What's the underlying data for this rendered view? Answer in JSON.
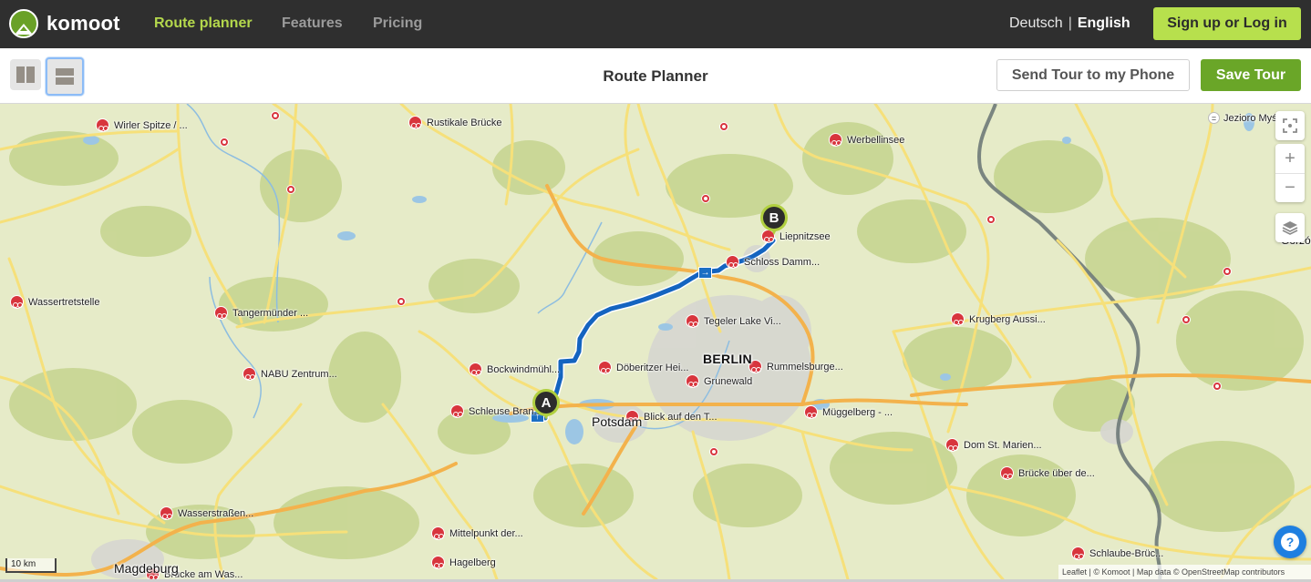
{
  "brand": {
    "name": "komoot",
    "accent": "#b4d84c",
    "primary_green": "#6aa628"
  },
  "topnav": {
    "links": [
      {
        "label": "Route planner",
        "active": true
      },
      {
        "label": "Features",
        "active": false
      },
      {
        "label": "Pricing",
        "active": false
      }
    ],
    "languages": {
      "other": "Deutsch",
      "separator": "|",
      "current": "English"
    },
    "signup_label": "Sign up or Log in"
  },
  "toolbar": {
    "layout_buttons": [
      {
        "icon": "layout-split-vertical-icon",
        "selected": false
      },
      {
        "icon": "layout-split-horizontal-icon",
        "selected": true
      }
    ],
    "title": "Route Planner",
    "send_label": "Send Tour to my Phone",
    "save_label": "Save Tour"
  },
  "map": {
    "route": {
      "start_label": "A",
      "end_label": "B",
      "color": "#1464c0"
    },
    "cities": [
      {
        "name": "BERLIN",
        "big": true
      },
      {
        "name": "Potsdam",
        "big": false
      },
      {
        "name": "Magdeburg",
        "big": false
      },
      {
        "name": "Gorzó",
        "big": false
      }
    ],
    "highlights": [
      "Wirler Spitze / ...",
      "Rustikale Brücke",
      "Werbellinsee",
      "Liepnitzsee",
      "Schloss Damm...",
      "Wassertretstelle",
      "Tangermünder ...",
      "Tegeler Lake Vi...",
      "Krugberg Aussi...",
      "NABU Zentrum...",
      "Bockwindmühl...",
      "Döberitzer Hei...",
      "Rummelsburge...",
      "Grunewald",
      "Schleuse Bran...",
      "Blick auf den T...",
      "Müggelberg - ...",
      "Dom St. Marien...",
      "Brücke über de...",
      "Wasserstraßen...",
      "Mittelpunkt der...",
      "Hagelberg",
      "Brücke am Was...",
      "Schlaube-Brüc..."
    ],
    "lake_label": "Jezioro Myś...",
    "controls": {
      "locate": "locate-icon",
      "zoom_in": "+",
      "zoom_out": "−",
      "layers": "layers-icon"
    },
    "scale_label": "10 km",
    "attribution": {
      "leaflet": "Leaflet",
      "komoot": "© Komoot",
      "osm": "Map data © OpenStreetMap contributors",
      "sep": " | "
    },
    "help_label": "?"
  }
}
